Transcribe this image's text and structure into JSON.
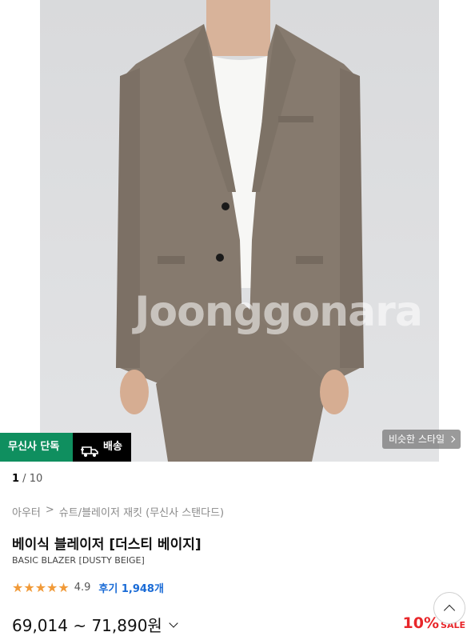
{
  "hero": {
    "watermark": "Joonggonara",
    "badges": {
      "exclusive": "무신사 단독",
      "shipping": "배송"
    },
    "similar_style": "비슷한 스타일"
  },
  "pager": {
    "current": "1",
    "separator": " / ",
    "total": "10"
  },
  "breadcrumb": {
    "level1": "아우터",
    "separator": ">",
    "level2": "슈트/블레이저 재킷 (무신사 스탠다드)"
  },
  "product": {
    "title": "베이식 블레이저 [더스티 베이지]",
    "subtitle": "BASIC BLAZER [DUSTY BEIGE]",
    "stars": "★★★★★",
    "rating": "4.9",
    "reviews": "후기 1,948개",
    "price": "69,014 ~ 71,890원",
    "discount": "10%",
    "sale_label": "SALE"
  },
  "colors": {
    "exclusive_bg": "#0f8f5f",
    "star": "#f19a38",
    "discount": "#e8262a",
    "review_link": "#1a6bd6"
  }
}
